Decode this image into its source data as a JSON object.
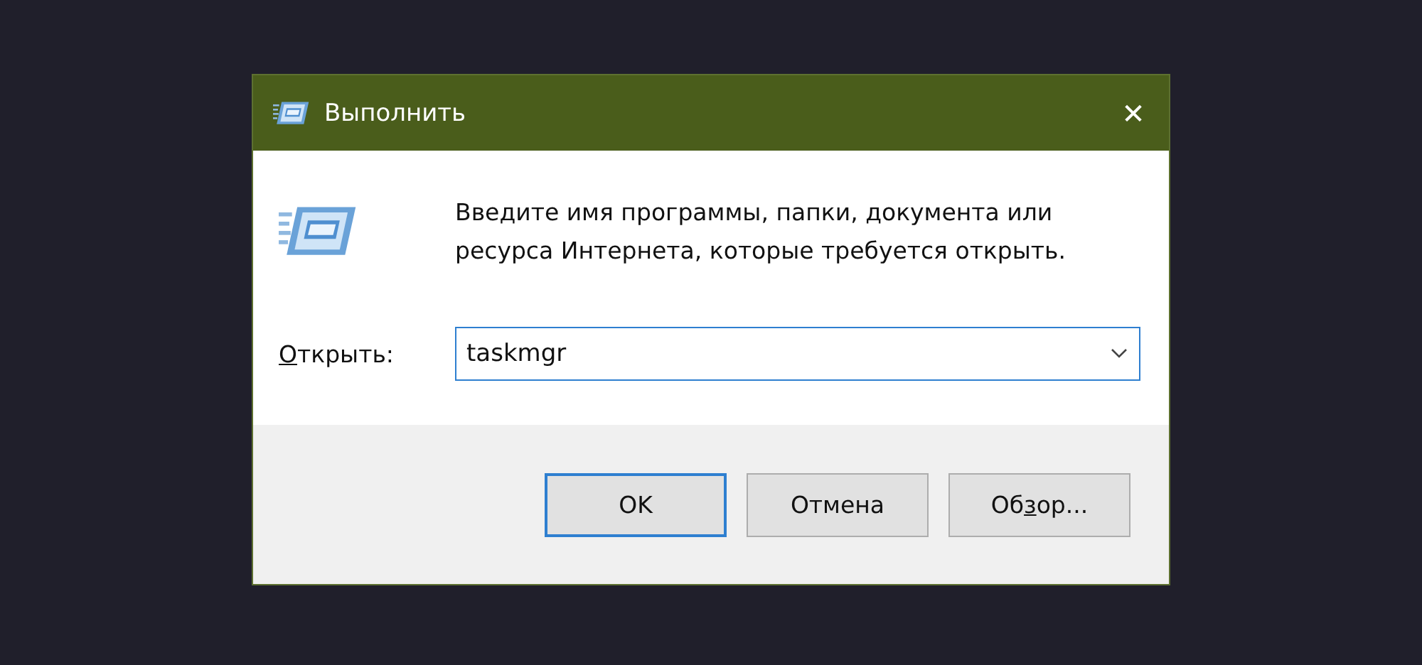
{
  "window": {
    "title": "Выполнить",
    "close": "✕"
  },
  "message": "Введите имя программы, папки, документа или ресурса Интернета, которые требуется открыть.",
  "open_field": {
    "label": [
      {
        "text": "О",
        "underlined": true
      },
      {
        "text": "ткрыть:",
        "underlined": false
      }
    ],
    "value": "taskmgr"
  },
  "buttons": [
    {
      "label": [
        {
          "text": "OK",
          "underlined": false
        }
      ],
      "default": true
    },
    {
      "label": [
        {
          "text": "Отмена",
          "underlined": false
        }
      ],
      "default": false
    },
    {
      "label": [
        {
          "text": "Об",
          "underlined": false
        },
        {
          "text": "з",
          "underlined": true
        },
        {
          "text": "ор...",
          "underlined": false
        }
      ],
      "default": false
    }
  ]
}
